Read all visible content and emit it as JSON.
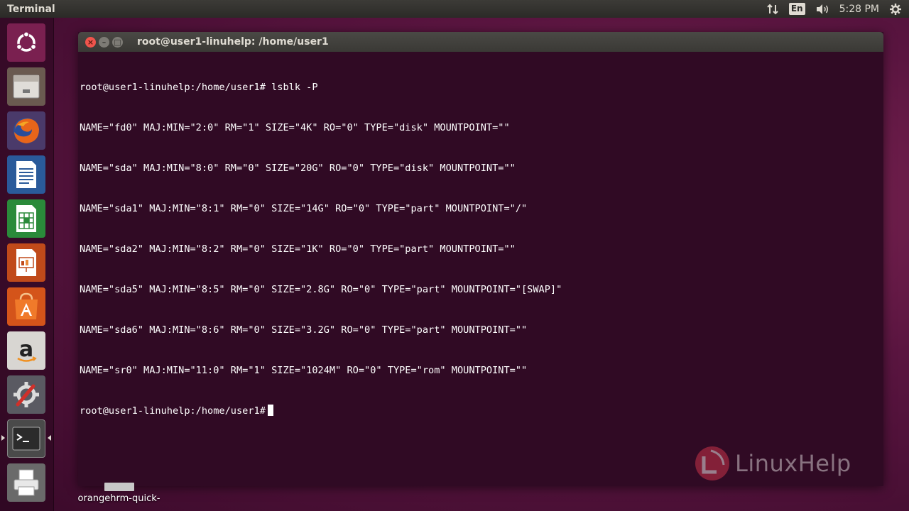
{
  "panel": {
    "app_title": "Terminal",
    "lang": "En",
    "time": "5:28 PM"
  },
  "launcher": {
    "items": [
      {
        "name": "ubuntu-dash-icon"
      },
      {
        "name": "files-icon"
      },
      {
        "name": "firefox-icon"
      },
      {
        "name": "libreoffice-writer-icon"
      },
      {
        "name": "libreoffice-calc-icon"
      },
      {
        "name": "libreoffice-impress-icon"
      },
      {
        "name": "software-center-icon"
      },
      {
        "name": "amazon-icon"
      },
      {
        "name": "system-settings-icon"
      },
      {
        "name": "terminal-icon"
      },
      {
        "name": "printer-icon"
      }
    ]
  },
  "terminal": {
    "title": "root@user1-linuhelp: /home/user1",
    "lines": [
      "root@user1-linuhelp:/home/user1# lsblk -P",
      "NAME=\"fd0\" MAJ:MIN=\"2:0\" RM=\"1\" SIZE=\"4K\" RO=\"0\" TYPE=\"disk\" MOUNTPOINT=\"\"",
      "NAME=\"sda\" MAJ:MIN=\"8:0\" RM=\"0\" SIZE=\"20G\" RO=\"0\" TYPE=\"disk\" MOUNTPOINT=\"\"",
      "NAME=\"sda1\" MAJ:MIN=\"8:1\" RM=\"0\" SIZE=\"14G\" RO=\"0\" TYPE=\"part\" MOUNTPOINT=\"/\"",
      "NAME=\"sda2\" MAJ:MIN=\"8:2\" RM=\"0\" SIZE=\"1K\" RO=\"0\" TYPE=\"part\" MOUNTPOINT=\"\"",
      "NAME=\"sda5\" MAJ:MIN=\"8:5\" RM=\"0\" SIZE=\"2.8G\" RO=\"0\" TYPE=\"part\" MOUNTPOINT=\"[SWAP]\"",
      "NAME=\"sda6\" MAJ:MIN=\"8:6\" RM=\"0\" SIZE=\"3.2G\" RO=\"0\" TYPE=\"part\" MOUNTPOINT=\"\"",
      "NAME=\"sr0\" MAJ:MIN=\"11:0\" RM=\"1\" SIZE=\"1024M\" RO=\"0\" TYPE=\"rom\" MOUNTPOINT=\"\""
    ],
    "prompt": "root@user1-linuhelp:/home/user1#"
  },
  "desktop": {
    "file_label": "orangehrm-quick-"
  },
  "watermark": {
    "text": "LinuxHelp"
  }
}
